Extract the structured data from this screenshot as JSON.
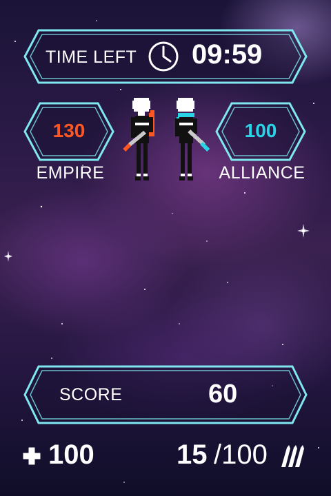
{
  "timer": {
    "label": "TIME LEFT",
    "value": "09:59",
    "icon": "clock-icon"
  },
  "teams": {
    "empire": {
      "score": "130",
      "name": "EMPIRE",
      "color": "#ff5722"
    },
    "alliance": {
      "score": "100",
      "name": "ALLIANCE",
      "color": "#2ad4e6"
    }
  },
  "score": {
    "label": "SCORE",
    "value": "60"
  },
  "health": {
    "value": "100",
    "icon": "plus-icon"
  },
  "ammo": {
    "current": "15",
    "max": "/100",
    "icon": "ammo-icon"
  },
  "colors": {
    "frame": "#7fe7f0",
    "panel_fill": "rgba(28,18,52,0.55)"
  }
}
